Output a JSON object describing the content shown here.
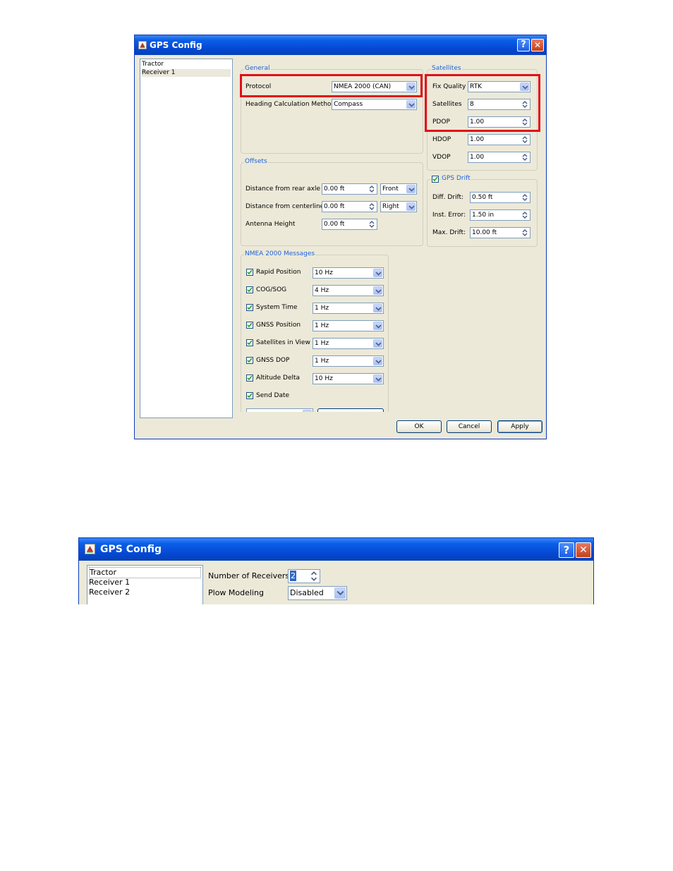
{
  "dialog1": {
    "title": "GPS Config",
    "help_glyph": "?",
    "close_glyph": "✕",
    "tree": [
      "Tractor",
      "Receiver 1"
    ],
    "selected_tree_item": "Receiver 1",
    "general": {
      "legend": "General",
      "protocol_label": "Protocol",
      "protocol_value": "NMEA 2000 (CAN)",
      "heading_label": "Heading Calculation Method",
      "heading_value": "Compass"
    },
    "satellites": {
      "legend": "Satellites",
      "fix_quality_label": "Fix Quality",
      "fix_quality_value": "RTK",
      "satellites_label": "Satellites",
      "satellites_value": "8",
      "pdop_label": "PDOP",
      "pdop_value": "1.00",
      "hdop_label": "HDOP",
      "hdop_value": "1.00",
      "vdop_label": "VDOP",
      "vdop_value": "1.00"
    },
    "offsets": {
      "legend": "Offsets",
      "rear_axle_label": "Distance from rear axle",
      "rear_axle_value": "0.00 ft",
      "rear_axle_dir": "Front",
      "centerline_label": "Distance from centerline",
      "centerline_value": "0.00 ft",
      "centerline_dir": "Right",
      "antenna_label": "Antenna Height",
      "antenna_value": "0.00 ft"
    },
    "gps_drift": {
      "legend": "GPS Drift",
      "enabled": true,
      "diff_label": "Diff. Drift:",
      "diff_value": "0.50 ft",
      "inst_label": "Inst. Error:",
      "inst_value": "1.50 in",
      "max_label": "Max. Drift:",
      "max_value": "10.00 ft"
    },
    "nmea": {
      "legend": "NMEA 2000 Messages",
      "messages": [
        {
          "label": "Rapid Position",
          "rate": "10 Hz",
          "checked": true
        },
        {
          "label": "COG/SOG",
          "rate": "4 Hz",
          "checked": true
        },
        {
          "label": "System Time",
          "rate": "1 Hz",
          "checked": true
        },
        {
          "label": "GNSS Position",
          "rate": "1 Hz",
          "checked": true
        },
        {
          "label": "Satellites in View",
          "rate": "1 Hz",
          "checked": true
        },
        {
          "label": "GNSS DOP",
          "rate": "1 Hz",
          "checked": true
        },
        {
          "label": "Altitude Delta",
          "rate": "10 Hz",
          "checked": true
        },
        {
          "label": "Send Date",
          "rate": "",
          "checked": true
        }
      ]
    },
    "buttons": {
      "ok": "OK",
      "cancel": "Cancel",
      "apply": "Apply"
    }
  },
  "dialog2": {
    "title": "GPS Config",
    "help_glyph": "?",
    "close_glyph": "✕",
    "tree": [
      "Tractor",
      "Receiver 1",
      "Receiver 2"
    ],
    "selected_tree_item": "Tractor",
    "num_receivers_label": "Number of Receivers",
    "num_receivers_value": "2",
    "plow_label": "Plow Modeling",
    "plow_value": "Disabled"
  },
  "colors": {
    "title_bar": "#0a5ee8",
    "dialog_bg": "#ece9d8",
    "group_legend": "#2164d8",
    "highlight_box": "#e0101a"
  },
  "icons": [
    "app-icon",
    "help-icon",
    "close-icon",
    "dropdown-arrow-icon",
    "spinner-arrows-icon",
    "checkmark-icon"
  ]
}
